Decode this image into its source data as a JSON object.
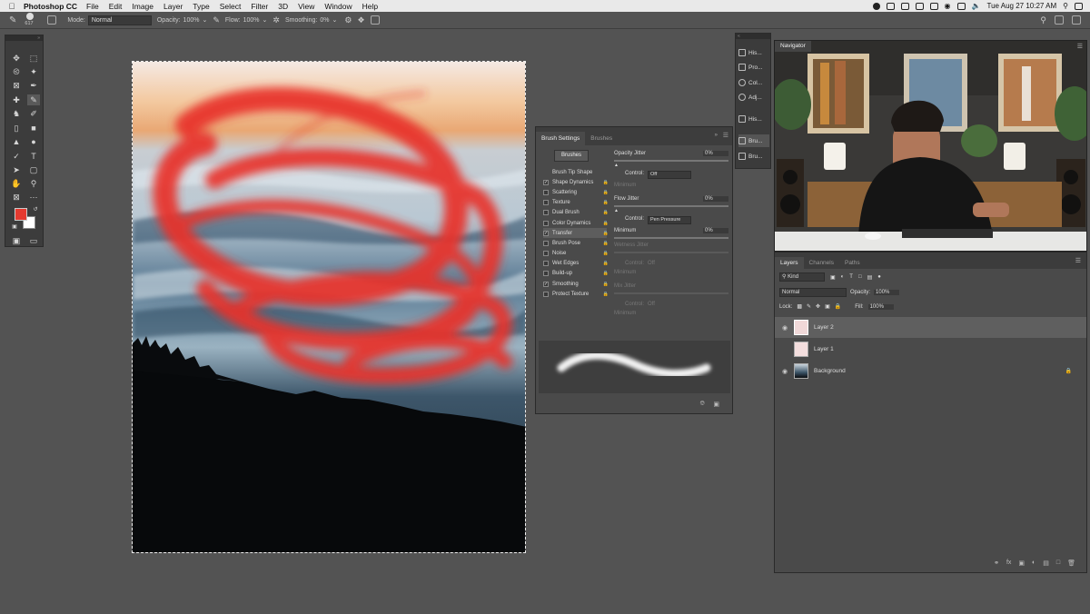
{
  "menubar": {
    "app_name": "Photoshop CC",
    "items": [
      "File",
      "Edit",
      "Image",
      "Layer",
      "Type",
      "Select",
      "Filter",
      "3D",
      "View",
      "Window",
      "Help"
    ],
    "clock": "Tue Aug 27  10:27 AM"
  },
  "options_bar": {
    "brush_size": "617",
    "mode_label": "Mode:",
    "mode_value": "Normal",
    "opacity_label": "Opacity:",
    "opacity_value": "100%",
    "flow_label": "Flow:",
    "flow_value": "100%",
    "smoothing_label": "Smoothing:",
    "smoothing_value": "0%"
  },
  "colors": {
    "foreground": "#e53a30",
    "background": "#ffffff",
    "stroke_red": "#e8332b"
  },
  "dock": {
    "items": [
      {
        "label": "His...",
        "icon": "history-icon"
      },
      {
        "label": "Pro...",
        "icon": "properties-icon"
      },
      {
        "label": "Col...",
        "icon": "color-icon"
      },
      {
        "label": "Adj...",
        "icon": "adjustments-icon"
      },
      {
        "label": "His...",
        "icon": "histogram-icon"
      },
      {
        "label": "Bru...",
        "icon": "brush-settings-icon"
      },
      {
        "label": "Bru...",
        "icon": "brushes-icon"
      }
    ]
  },
  "brush_settings": {
    "tabs": [
      "Brush Settings",
      "Brushes"
    ],
    "brushes_button": "Brushes",
    "items": [
      {
        "label": "Brush Tip Shape",
        "checkbox": false,
        "checked": false
      },
      {
        "label": "Shape Dynamics",
        "checkbox": true,
        "checked": true
      },
      {
        "label": "Scattering",
        "checkbox": true,
        "checked": false
      },
      {
        "label": "Texture",
        "checkbox": true,
        "checked": false
      },
      {
        "label": "Dual Brush",
        "checkbox": true,
        "checked": false
      },
      {
        "label": "Color Dynamics",
        "checkbox": true,
        "checked": false
      },
      {
        "label": "Transfer",
        "checkbox": true,
        "checked": true,
        "selected": true
      },
      {
        "label": "Brush Pose",
        "checkbox": true,
        "checked": false
      },
      {
        "label": "Noise",
        "checkbox": true,
        "checked": false
      },
      {
        "label": "Wet Edges",
        "checkbox": true,
        "checked": false
      },
      {
        "label": "Build-up",
        "checkbox": true,
        "checked": false
      },
      {
        "label": "Smoothing",
        "checkbox": true,
        "checked": true
      },
      {
        "label": "Protect Texture",
        "checkbox": true,
        "checked": false
      }
    ],
    "opacity_jitter_label": "Opacity Jitter",
    "opacity_jitter_value": "0%",
    "control_label": "Control:",
    "control1_value": "Off",
    "minimum_label": "Minimum",
    "flow_jitter_label": "Flow Jitter",
    "flow_jitter_value": "0%",
    "control2_value": "Pen Pressure",
    "minimum_value": "0%",
    "wetness_jitter_label": "Wetness Jitter",
    "control3_value": "Off",
    "mix_jitter_label": "Mix Jitter",
    "control4_value": "Off"
  },
  "navigator": {
    "tab": "Navigator"
  },
  "layers_panel": {
    "tabs": [
      "Layers",
      "Channels",
      "Paths"
    ],
    "filter_kind": "Kind",
    "blend_mode": "Normal",
    "opacity_label": "Opacity:",
    "opacity_value": "100%",
    "lock_label": "Lock:",
    "fill_label": "Fill:",
    "fill_value": "100%",
    "layers": [
      {
        "name": "Layer 2",
        "visible": true,
        "selected": true
      },
      {
        "name": "Layer 1",
        "visible": false,
        "selected": false
      },
      {
        "name": "Background",
        "visible": true,
        "selected": false,
        "locked": true
      }
    ]
  }
}
